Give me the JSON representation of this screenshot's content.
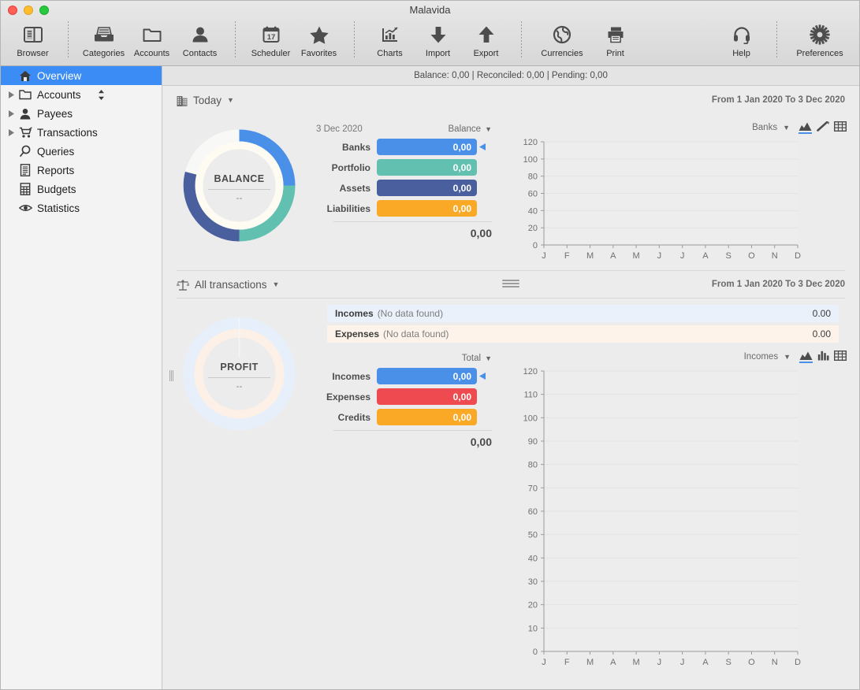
{
  "window": {
    "title": "Malavida"
  },
  "traffic": {
    "close": "close-button",
    "minimize": "minimize-button",
    "zoom": "zoom-button"
  },
  "toolbar": {
    "groups": [
      {
        "items": [
          {
            "id": "browser",
            "label": "Browser",
            "icon": "browser-icon"
          }
        ]
      },
      {
        "items": [
          {
            "id": "categories",
            "label": "Categories",
            "icon": "categories-icon"
          },
          {
            "id": "accounts",
            "label": "Accounts",
            "icon": "accounts-folder-icon"
          },
          {
            "id": "contacts",
            "label": "Contacts",
            "icon": "contacts-person-icon"
          }
        ]
      },
      {
        "items": [
          {
            "id": "scheduler",
            "label": "Scheduler",
            "icon": "calendar-icon"
          },
          {
            "id": "favorites",
            "label": "Favorites",
            "icon": "star-icon"
          }
        ]
      },
      {
        "items": [
          {
            "id": "charts",
            "label": "Charts",
            "icon": "chart-icon"
          },
          {
            "id": "import",
            "label": "Import",
            "icon": "arrow-down-icon"
          },
          {
            "id": "export",
            "label": "Export",
            "icon": "arrow-up-icon"
          }
        ]
      },
      {
        "items": [
          {
            "id": "currencies",
            "label": "Currencies",
            "icon": "globe-icon"
          },
          {
            "id": "print",
            "label": "Print",
            "icon": "printer-icon"
          }
        ]
      },
      {
        "items": [
          {
            "id": "help",
            "label": "Help",
            "icon": "headset-icon"
          }
        ]
      },
      {
        "items": [
          {
            "id": "preferences",
            "label": "Preferences",
            "icon": "gear-icon"
          }
        ]
      }
    ]
  },
  "sidebar": {
    "items": [
      {
        "id": "overview",
        "label": "Overview",
        "icon": "home-icon",
        "selected": true,
        "expandable": false
      },
      {
        "id": "accounts",
        "label": "Accounts",
        "icon": "folder-icon",
        "selected": false,
        "expandable": true,
        "sortable": true
      },
      {
        "id": "payees",
        "label": "Payees",
        "icon": "person-icon",
        "selected": false,
        "expandable": true
      },
      {
        "id": "transactions",
        "label": "Transactions",
        "icon": "cart-icon",
        "selected": false,
        "expandable": true
      },
      {
        "id": "queries",
        "label": "Queries",
        "icon": "magnifier-icon",
        "selected": false,
        "expandable": false
      },
      {
        "id": "reports",
        "label": "Reports",
        "icon": "document-icon",
        "selected": false,
        "expandable": false
      },
      {
        "id": "budgets",
        "label": "Budgets",
        "icon": "calculator-icon",
        "selected": false,
        "expandable": false
      },
      {
        "id": "statistics",
        "label": "Statistics",
        "icon": "eye-icon",
        "selected": false,
        "expandable": false
      }
    ]
  },
  "statusbar": {
    "text": "Balance: 0,00 | Reconciled: 0,00 | Pending: 0,00"
  },
  "today": {
    "title": "Today",
    "icon": "building-icon",
    "caret": "▼",
    "range": "From 1 Jan 2020 To 3 Dec 2020",
    "donut": {
      "label": "BALANCE",
      "value": "--"
    },
    "bars_date": "3 Dec 2020",
    "bars_mode": "Balance",
    "bars": [
      {
        "label": "Banks",
        "value": "0,00",
        "color": "#4a90e8",
        "marked": true
      },
      {
        "label": "Portfolio",
        "value": "0,00",
        "color": "#62c0b0",
        "marked": false
      },
      {
        "label": "Assets",
        "value": "0,00",
        "color": "#4a5f9e",
        "marked": false
      },
      {
        "label": "Liabilities",
        "value": "0,00",
        "color": "#f9a926",
        "marked": false
      }
    ],
    "total": "0,00"
  },
  "transactions": {
    "title": "All transactions",
    "icon": "scales-icon",
    "caret": "▼",
    "range": "From 1 Jan 2020 To 3 Dec 2020",
    "donut": {
      "label": "PROFIT",
      "value": "--"
    },
    "summary": [
      {
        "name": "Incomes",
        "note": "(No data found)",
        "amount": "0.00",
        "tone": "inc"
      },
      {
        "name": "Expenses",
        "note": "(No data found)",
        "amount": "0.00",
        "tone": "exp"
      }
    ],
    "bars_mode": "Total",
    "bars": [
      {
        "label": "Incomes",
        "value": "0,00",
        "color": "#4a90e8",
        "marked": true
      },
      {
        "label": "Expenses",
        "value": "0,00",
        "color": "#ef4a4f",
        "marked": false
      },
      {
        "label": "Credits",
        "value": "0,00",
        "color": "#f9a926",
        "marked": false
      }
    ],
    "total": "0,00"
  },
  "chart_data": [
    {
      "id": "today-chart",
      "type": "area",
      "title": "",
      "series_label": "Banks",
      "view_icons": [
        "area-chart-icon",
        "line-chart-icon",
        "table-icon"
      ],
      "active_view": "area-chart-icon",
      "categories": [
        "J",
        "F",
        "M",
        "A",
        "M",
        "J",
        "J",
        "A",
        "S",
        "O",
        "N",
        "D"
      ],
      "series": [
        {
          "name": "Banks",
          "values": [
            0,
            0,
            0,
            0,
            0,
            0,
            0,
            0,
            0,
            0,
            0,
            0
          ]
        }
      ],
      "yticks": [
        0,
        20,
        40,
        60,
        80,
        100,
        120
      ],
      "ylim": [
        0,
        120
      ],
      "xlabel": "",
      "ylabel": "",
      "grid": true,
      "legend": "none"
    },
    {
      "id": "transactions-chart",
      "type": "area",
      "title": "",
      "series_label": "Incomes",
      "view_icons": [
        "area-chart-icon",
        "bar-chart-icon",
        "table-icon"
      ],
      "active_view": "area-chart-icon",
      "categories": [
        "J",
        "F",
        "M",
        "A",
        "M",
        "J",
        "J",
        "A",
        "S",
        "O",
        "N",
        "D"
      ],
      "series": [
        {
          "name": "Incomes",
          "values": [
            0,
            0,
            0,
            0,
            0,
            0,
            0,
            0,
            0,
            0,
            0,
            0
          ]
        }
      ],
      "yticks": [
        0,
        10,
        20,
        30,
        40,
        50,
        60,
        70,
        80,
        90,
        100,
        110,
        120
      ],
      "ylim": [
        0,
        120
      ],
      "xlabel": "",
      "ylabel": "",
      "grid": true,
      "legend": "none"
    },
    {
      "id": "balance-donut",
      "type": "pie",
      "title": "BALANCE",
      "labels": [
        "Banks",
        "Portfolio",
        "Assets",
        "Liabilities"
      ],
      "values": [
        25,
        25,
        22,
        28
      ],
      "colors": [
        "#4a90e8",
        "#62c0b0",
        "#4a5f9e",
        "#f7f7f5"
      ]
    },
    {
      "id": "profit-donut",
      "type": "pie",
      "title": "PROFIT",
      "labels": [
        "Incomes",
        "Expenses"
      ],
      "values": [
        100,
        100
      ],
      "colors": [
        "#e7effb",
        "#fdf0e6"
      ]
    }
  ]
}
